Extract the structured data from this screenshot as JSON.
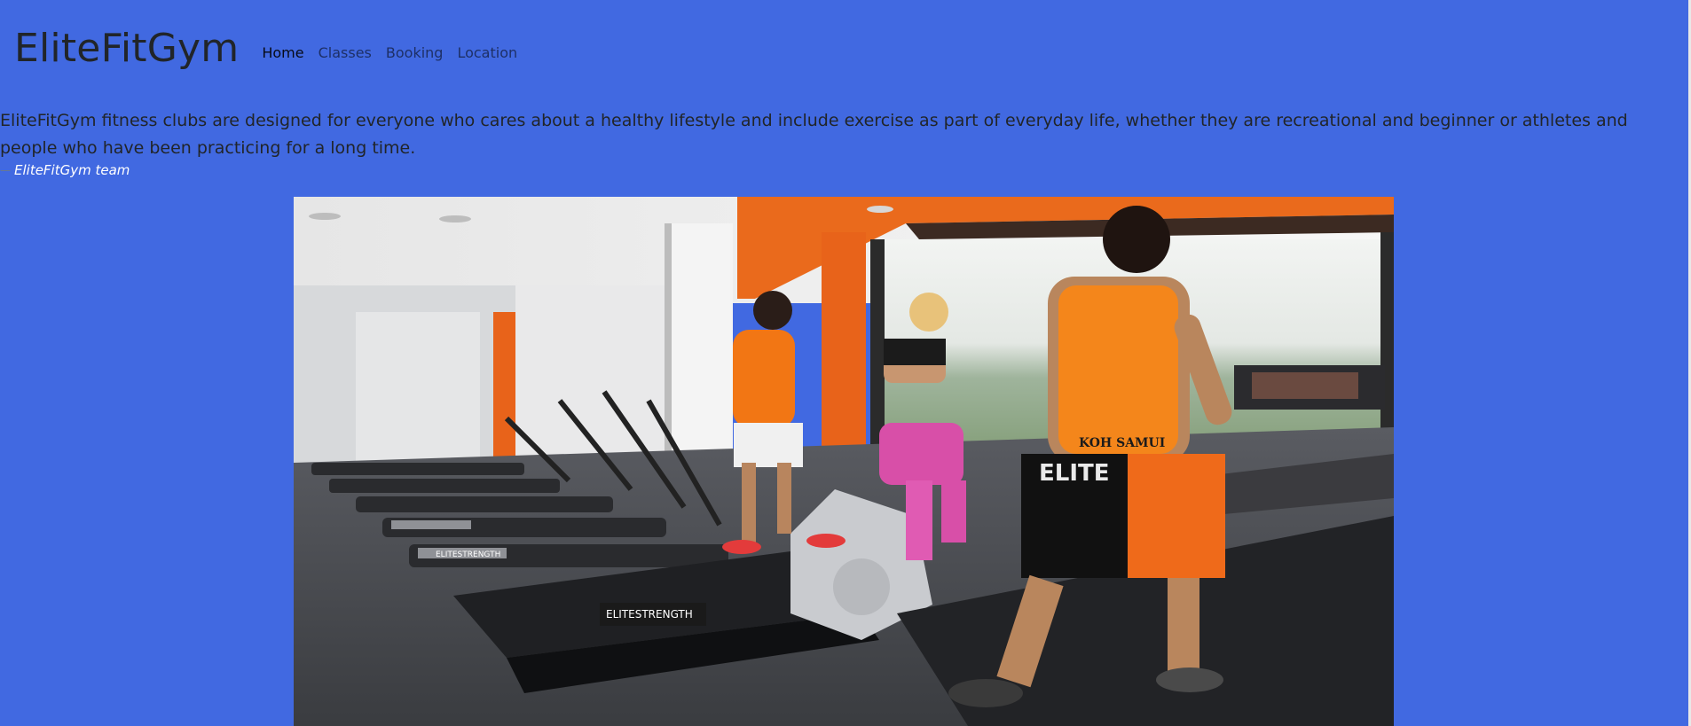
{
  "brand": "EliteFitGym",
  "nav": {
    "items": [
      {
        "label": "Home",
        "active": true
      },
      {
        "label": "Classes",
        "active": false
      },
      {
        "label": "Booking",
        "active": false
      },
      {
        "label": "Location",
        "active": false
      }
    ]
  },
  "quote": {
    "text": "EliteFitGym fitness clubs are designed for everyone who cares about a healthy lifestyle and include exercise as part of everyday life, whether they are recreational and beginner or athletes and people who have been practicing for a long time.",
    "attribution_dash": "—",
    "attribution": "EliteFitGym team"
  },
  "hero_image": {
    "visible_text": {
      "tank_top": "KOH SAMUI",
      "shorts": "ELITE",
      "treadmill_label": "ELITESTRENGTH",
      "treadmill_label_far": "ELITESTRENGTH"
    }
  },
  "colors": {
    "page_background": "#4169e1",
    "nav_active": "rgba(0,0,0,0.9)",
    "nav_inactive": "rgba(0,0,0,0.55)",
    "attribution": "#ffffff"
  }
}
